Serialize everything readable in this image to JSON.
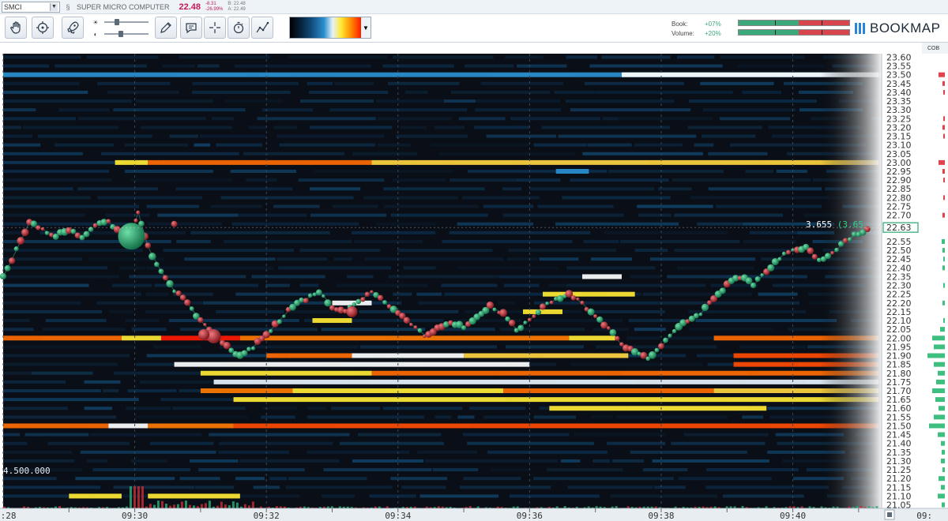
{
  "header": {
    "symbol": "SMCI",
    "company": "SUPER MICRO COMPUTER",
    "last_price": "22.48",
    "change_abs": "-8.31",
    "change_pct": "-26.99%",
    "bid": "B: 22.48",
    "ask": "A: 22.49"
  },
  "toolbar": {
    "tools": [
      {
        "name": "hand-tool-button",
        "icon": "hand-icon"
      },
      {
        "name": "zoom-target-button",
        "icon": "target-icon"
      },
      {
        "name": "rocket-button",
        "icon": "rocket-icon"
      },
      {
        "name": "draw-tool-button",
        "icon": "pencil-icon"
      },
      {
        "name": "comment-tool-button",
        "icon": "speech-bubble-icon"
      },
      {
        "name": "crosshair-tool-button",
        "icon": "crosshair-icon"
      },
      {
        "name": "timer-tool-button",
        "icon": "stopwatch-icon"
      },
      {
        "name": "line-tool-button",
        "icon": "line-chart-icon"
      }
    ],
    "slider_contrast": 0.25,
    "slider_brightness": 0.35,
    "stats": {
      "book_label": "Book:",
      "book_value": "+07%",
      "volume_label": "Volume:",
      "volume_value": "+20%",
      "book_bid_share": 0.54,
      "volume_buy_share": 0.54
    },
    "logo_text": "BOOKMAP"
  },
  "chart": {
    "cob_label": "COB",
    "price_levels": [
      "23.60",
      "23.55",
      "23.50",
      "23.45",
      "23.40",
      "23.35",
      "23.30",
      "23.25",
      "23.20",
      "23.15",
      "23.10",
      "23.05",
      "23.00",
      "22.95",
      "22.90",
      "22.85",
      "22.80",
      "22.75",
      "22.70",
      "22.63",
      "22.55",
      "22.50",
      "22.45",
      "22.40",
      "22.35",
      "22.30",
      "22.25",
      "22.20",
      "22.15",
      "22.10",
      "22.05",
      "22.00",
      "21.95",
      "21.90",
      "21.85",
      "21.80",
      "21.75",
      "21.70",
      "21.65",
      "21.60",
      "21.55",
      "21.50",
      "21.45",
      "21.40",
      "21.35",
      "21.30",
      "21.25",
      "21.20",
      "21.15",
      "21.10",
      "21.05"
    ],
    "current_price_label": "22.63",
    "time_labels": [
      "09:28",
      "09:30",
      "09:32",
      "09:34",
      "09:36",
      "09:38",
      "09:40",
      "09:"
    ],
    "volume_scale_label": "4.500.000",
    "crosshair_value": "3.655",
    "crosshair_alt": "(3.65",
    "colors": {
      "background": "#0a0f17",
      "buy": "#2aa673",
      "sell": "#c22a34",
      "ladder_green": "#3fbf7f",
      "ladder_red": "#e0434d"
    }
  }
}
